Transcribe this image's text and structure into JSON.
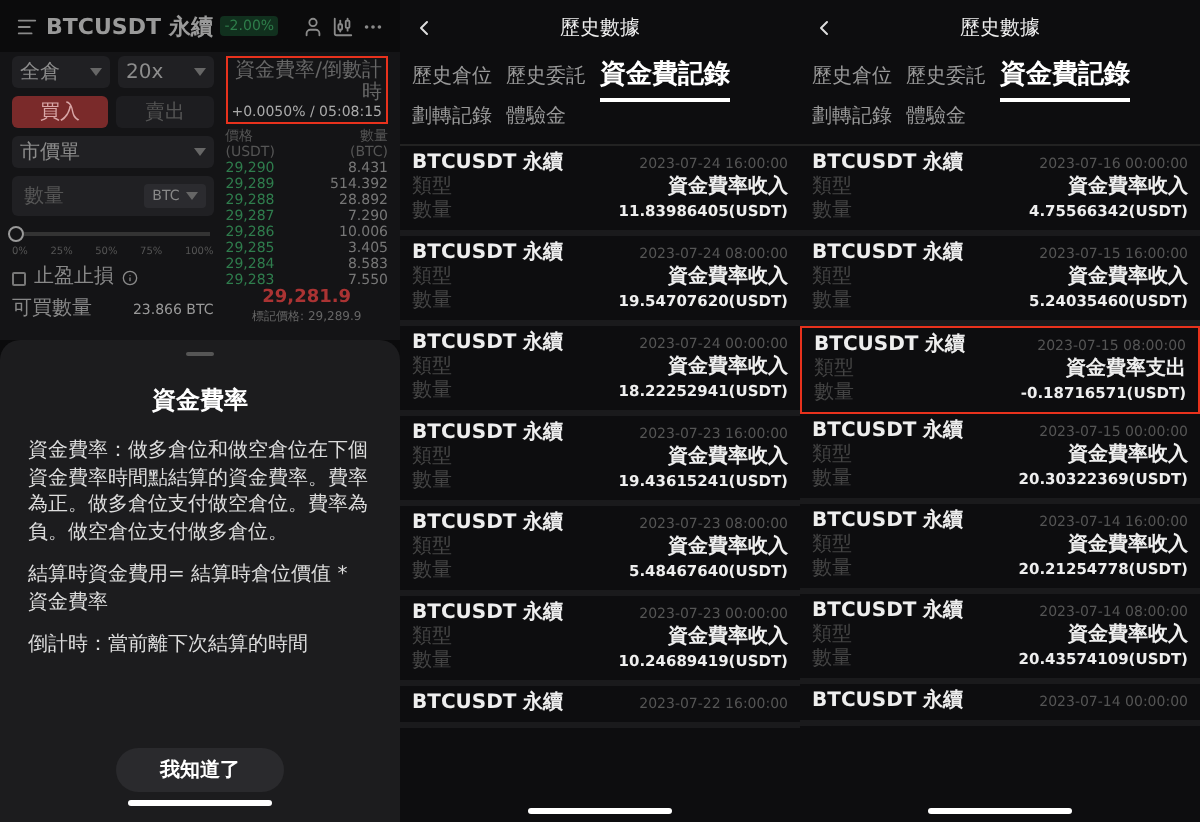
{
  "trade_screen": {
    "header": {
      "symbol": "BTCUSDT 永續",
      "change": "-2.00%"
    },
    "form": {
      "margin_mode": "全倉",
      "leverage": "20x",
      "sides": [
        {
          "label": "買入",
          "selected": true
        },
        {
          "label": "賣出",
          "selected": false
        }
      ],
      "order_type": "市價單",
      "quantity": {
        "placeholder": "數量",
        "unit": "BTC"
      },
      "slider": {
        "level": 0,
        "ticks": [
          "0%",
          "25%",
          "50%",
          "75%",
          "100%"
        ]
      },
      "tpsl": {
        "label": "止盈止損",
        "checked": false
      },
      "available": {
        "label": "可買數量",
        "value": "23.866 BTC"
      }
    },
    "funding": {
      "label": "資金費率/倒數計時",
      "value": "+0.0050% / 05:08:15",
      "highlighted": true
    },
    "order_book": {
      "columns": [
        "價格 (USDT)",
        "數量 (BTC)"
      ],
      "rows": [
        {
          "price": "29,290",
          "amount": "8.431"
        },
        {
          "price": "29,289",
          "amount": "514.392"
        },
        {
          "price": "29,288",
          "amount": "28.892"
        },
        {
          "price": "29,287",
          "amount": "7.290"
        },
        {
          "price": "29,286",
          "amount": "10.006"
        },
        {
          "price": "29,285",
          "amount": "3.405"
        },
        {
          "price": "29,284",
          "amount": "8.583"
        },
        {
          "price": "29,283",
          "amount": "7.550"
        }
      ],
      "last_price": "29,281.9",
      "mark_price": "標記價格: 29,289.9"
    },
    "sheet": {
      "title": "資金費率",
      "paragraphs": [
        "資金費率：做多倉位和做空倉位在下個資金費率時間點結算的資金費率。費率為正。做多倉位支付做空倉位。費率為負。做空倉位支付做多倉位。",
        "結算時資金費用= 結算時倉位價值 * 資金費率",
        "倒計時：當前離下次結算的時間"
      ],
      "button": "我知道了"
    }
  },
  "history_screens": [
    {
      "title": "歷史數據",
      "tabs": [
        {
          "label": "歷史倉位",
          "selected": false
        },
        {
          "label": "歷史委託",
          "selected": false
        },
        {
          "label": "資金費記錄",
          "selected": true
        },
        {
          "label": "劃轉記錄",
          "selected": false
        },
        {
          "label": "體驗金",
          "selected": false
        }
      ],
      "records": [
        {
          "name": "BTCUSDT 永續",
          "time": "2023-07-24 16:00:00",
          "type_label": "類型",
          "type": "資金費率收入",
          "amount_label": "數量",
          "amount": "11.83986405(USDT)",
          "highlighted": false
        },
        {
          "name": "BTCUSDT 永續",
          "time": "2023-07-24 08:00:00",
          "type_label": "類型",
          "type": "資金費率收入",
          "amount_label": "數量",
          "amount": "19.54707620(USDT)",
          "highlighted": false
        },
        {
          "name": "BTCUSDT 永續",
          "time": "2023-07-24 00:00:00",
          "type_label": "類型",
          "type": "資金費率收入",
          "amount_label": "數量",
          "amount": "18.22252941(USDT)",
          "highlighted": false
        },
        {
          "name": "BTCUSDT 永續",
          "time": "2023-07-23 16:00:00",
          "type_label": "類型",
          "type": "資金費率收入",
          "amount_label": "數量",
          "amount": "19.43615241(USDT)",
          "highlighted": false
        },
        {
          "name": "BTCUSDT 永續",
          "time": "2023-07-23 08:00:00",
          "type_label": "類型",
          "type": "資金費率收入",
          "amount_label": "數量",
          "amount": "5.48467640(USDT)",
          "highlighted": false
        },
        {
          "name": "BTCUSDT 永續",
          "time": "2023-07-23 00:00:00",
          "type_label": "類型",
          "type": "資金費率收入",
          "amount_label": "數量",
          "amount": "10.24689419(USDT)",
          "highlighted": false
        },
        {
          "name": "BTCUSDT 永續",
          "time": "2023-07-22 16:00:00",
          "highlighted": false
        }
      ]
    },
    {
      "title": "歷史數據",
      "tabs": [
        {
          "label": "歷史倉位",
          "selected": false
        },
        {
          "label": "歷史委託",
          "selected": false
        },
        {
          "label": "資金費記錄",
          "selected": true
        },
        {
          "label": "劃轉記錄",
          "selected": false
        },
        {
          "label": "體驗金",
          "selected": false
        }
      ],
      "records": [
        {
          "name": "BTCUSDT 永續",
          "time": "2023-07-16 00:00:00",
          "type_label": "類型",
          "type": "資金費率收入",
          "amount_label": "數量",
          "amount": "4.75566342(USDT)",
          "highlighted": false
        },
        {
          "name": "BTCUSDT 永續",
          "time": "2023-07-15 16:00:00",
          "type_label": "類型",
          "type": "資金費率收入",
          "amount_label": "數量",
          "amount": "5.24035460(USDT)",
          "highlighted": false
        },
        {
          "name": "BTCUSDT 永續",
          "time": "2023-07-15 08:00:00",
          "type_label": "類型",
          "type": "資金費率支出",
          "amount_label": "數量",
          "amount": "-0.18716571(USDT)",
          "highlighted": true
        },
        {
          "name": "BTCUSDT 永續",
          "time": "2023-07-15 00:00:00",
          "type_label": "類型",
          "type": "資金費率收入",
          "amount_label": "數量",
          "amount": "20.30322369(USDT)",
          "highlighted": false
        },
        {
          "name": "BTCUSDT 永續",
          "time": "2023-07-14 16:00:00",
          "type_label": "類型",
          "type": "資金費率收入",
          "amount_label": "數量",
          "amount": "20.21254778(USDT)",
          "highlighted": false
        },
        {
          "name": "BTCUSDT 永續",
          "time": "2023-07-14 08:00:00",
          "type_label": "類型",
          "type": "資金費率收入",
          "amount_label": "數量",
          "amount": "20.43574109(USDT)",
          "highlighted": false
        },
        {
          "name": "BTCUSDT 永續",
          "time": "2023-07-14 00:00:00",
          "highlighted": false
        }
      ]
    }
  ]
}
